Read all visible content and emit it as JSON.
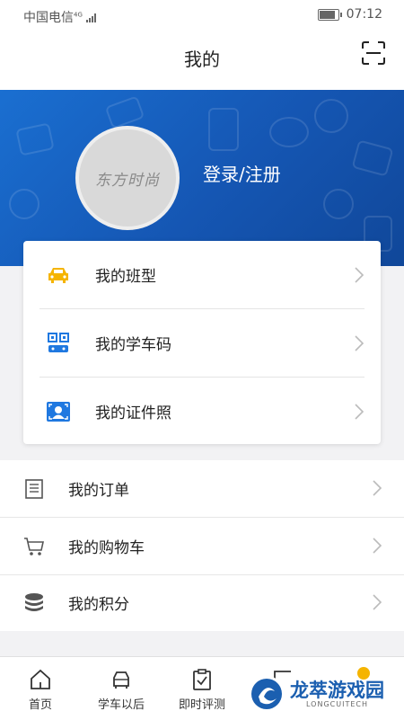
{
  "status": {
    "carrier": "中国电信",
    "network": "4G",
    "time": "07:12",
    "battery_level": 0.8
  },
  "header": {
    "title": "我的"
  },
  "profile": {
    "avatar_text": "东方时尚",
    "login_label": "登录/注册"
  },
  "card_items": [
    {
      "label": "我的班型",
      "icon": "car-icon"
    },
    {
      "label": "我的学车码",
      "icon": "qr-code-icon"
    },
    {
      "label": "我的证件照",
      "icon": "id-photo-icon"
    }
  ],
  "list_items": [
    {
      "label": "我的订单",
      "icon": "order-list-icon"
    },
    {
      "label": "我的购物车",
      "icon": "cart-icon"
    },
    {
      "label": "我的积分",
      "icon": "points-coins-icon"
    }
  ],
  "tabs": [
    {
      "label": "首页",
      "icon": "home-icon"
    },
    {
      "label": "学车以后",
      "icon": "car-front-icon"
    },
    {
      "label": "即时评测",
      "icon": "clipboard-check-icon"
    }
  ],
  "watermark": {
    "title": "龙萃游戏园",
    "subtitle": "LONGCUITECH"
  },
  "colors": {
    "accent": "#1a6fd1",
    "car_yellow": "#f5b400",
    "icon_blue": "#1f78e0"
  }
}
